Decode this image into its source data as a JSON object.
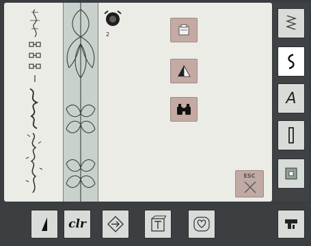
{
  "stitch_indicator": {
    "count": "2"
  },
  "tools": {
    "memory": "memory-icon",
    "mirror": "mirror-icon",
    "search": "binoculars-icon"
  },
  "esc_button": {
    "label": "ESC"
  },
  "sidebar": {
    "items": [
      {
        "name": "practical-stitches",
        "icon": "zigzag-icon"
      },
      {
        "name": "decorative-stitches",
        "icon": "s-stitch-icon"
      },
      {
        "name": "alphabets",
        "icon": "letter-a-icon",
        "label": "A"
      },
      {
        "name": "buttonholes",
        "icon": "buttonhole-icon"
      },
      {
        "name": "quilt-stitches",
        "icon": "quilt-icon"
      }
    ]
  },
  "bottom_bar": {
    "items": [
      {
        "name": "stitch-altitude",
        "icon": "altitude-icon"
      },
      {
        "name": "clear",
        "label": "clr"
      },
      {
        "name": "navigation",
        "icon": "move-icon"
      },
      {
        "name": "text-tool",
        "icon": "t-square-icon"
      },
      {
        "name": "favorites",
        "icon": "heart-icon"
      },
      {
        "name": "setup",
        "icon": "machine-icon"
      }
    ]
  },
  "colors": {
    "accent": "#c4aaa2",
    "screen": "#ecece7",
    "frame": "#3a3d3f"
  }
}
